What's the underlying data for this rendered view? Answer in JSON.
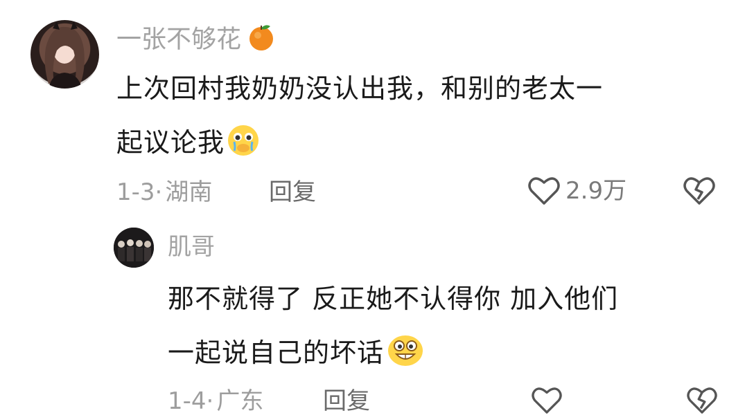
{
  "comments": [
    {
      "username": "一张不够花",
      "badge_icon": "orange-emoji-icon",
      "lines": [
        "上次回村我奶奶没认出我，和别的老太一",
        "起议论我"
      ],
      "trailing_emoji": "crying-emoji-icon",
      "date": "1-3",
      "location": "湖南",
      "reply_label": "回复",
      "likes": "2.9万"
    },
    {
      "username": "肌哥",
      "lines": [
        "那不就得了 反正她不认得你 加入他们",
        "一起说自己的坏话"
      ],
      "trailing_emoji": "grinning-emoji-icon",
      "date": "1-4",
      "location": "广东",
      "reply_label": "回复"
    }
  ],
  "meta_separator": "·",
  "colors": {
    "text_primary": "#1a1a1a",
    "text_secondary": "#a3a3a3",
    "background": "#ffffff"
  }
}
